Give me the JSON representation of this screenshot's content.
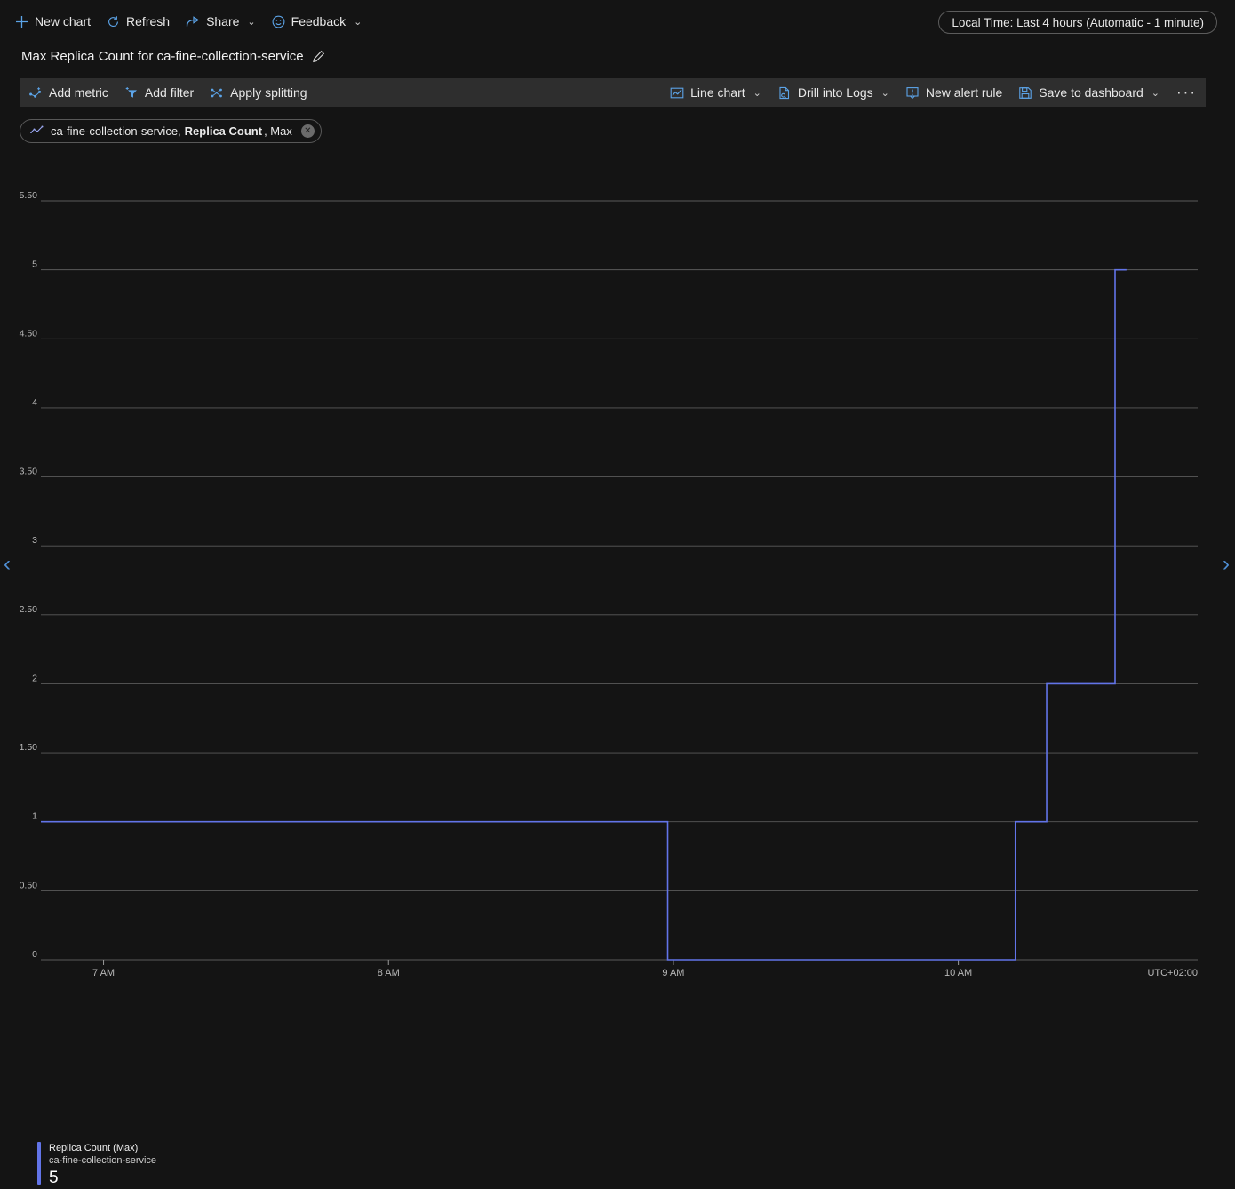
{
  "command_bar": {
    "items": [
      {
        "label": "New chart",
        "icon": "plus-icon"
      },
      {
        "label": "Refresh",
        "icon": "refresh-icon"
      },
      {
        "label": "Share",
        "icon": "share-icon",
        "chevron": "⌄"
      },
      {
        "label": "Feedback",
        "icon": "smiley-icon",
        "chevron": "⌄"
      }
    ],
    "time_range": "Local Time: Last 4 hours (Automatic - 1 minute)"
  },
  "chart_header": {
    "title": "Max Replica Count for ca-fine-collection-service",
    "edit_icon": "pencil-icon"
  },
  "toolbar": {
    "left": [
      {
        "label": "Add metric",
        "icon": "add-metric-icon"
      },
      {
        "label": "Add filter",
        "icon": "add-filter-icon"
      },
      {
        "label": "Apply splitting",
        "icon": "apply-splitting-icon"
      }
    ],
    "right": [
      {
        "label": "Line chart",
        "icon": "line-chart-icon",
        "chevron": "⌄"
      },
      {
        "label": "Drill into Logs",
        "icon": "drill-logs-icon",
        "chevron": "⌄"
      },
      {
        "label": "New alert rule",
        "icon": "alert-rule-icon",
        "chevron": ""
      },
      {
        "label": "Save to dashboard",
        "icon": "save-icon",
        "chevron": "⌄"
      }
    ],
    "overflow_label": "···"
  },
  "metric_chip": {
    "icon": "scatter-line-icon",
    "resource": "ca-fine-collection-service,",
    "metric": "Replica Count",
    "aggregation": ", Max",
    "close_icon": "close-icon"
  },
  "navigation": {
    "prev_icon": "chevron-left-icon",
    "next_icon": "chevron-right-icon"
  },
  "legend": {
    "metric_label": "Replica Count (Max)",
    "resource_label": "ca-fine-collection-service",
    "value": "5",
    "color": "#6274e8"
  },
  "colors": {
    "background": "#141414",
    "toolbar_background": "#2e2e2e",
    "series": "#6274e8",
    "gridline": "#5a5a5a",
    "accent_icon": "#5ca4e8"
  },
  "chart_data": {
    "type": "line",
    "title": "Max Replica Count for ca-fine-collection-service",
    "xlabel": "",
    "ylabel": "",
    "timezone_label": "UTC+02:00",
    "grid": true,
    "legend_position": "bottom-left",
    "interpolation": "step-after",
    "ylim": [
      0,
      5.5
    ],
    "ytick_labels": [
      "5.50",
      "5",
      "4.50",
      "4",
      "3.50",
      "3",
      "2.50",
      "2",
      "1.50",
      "1",
      "0.50",
      "0"
    ],
    "ytick_values": [
      5.5,
      5,
      4.5,
      4,
      3.5,
      3,
      2.5,
      2,
      1.5,
      1,
      0.5,
      0
    ],
    "xtick_labels": [
      "7 AM",
      "8 AM",
      "9 AM",
      "10 AM"
    ],
    "xtick_times": [
      7.0,
      8.0,
      9.0,
      10.0
    ],
    "xlim": [
      6.78,
      10.84
    ],
    "series": [
      {
        "name": "Replica Count (Max)",
        "resource": "ca-fine-collection-service",
        "color": "#6274e8",
        "points": [
          {
            "t": 6.78,
            "v": 1
          },
          {
            "t": 8.98,
            "v": 1
          },
          {
            "t": 8.98,
            "v": 0
          },
          {
            "t": 10.2,
            "v": 0
          },
          {
            "t": 10.2,
            "v": 1
          },
          {
            "t": 10.31,
            "v": 1
          },
          {
            "t": 10.31,
            "v": 2
          },
          {
            "t": 10.55,
            "v": 2
          },
          {
            "t": 10.55,
            "v": 5
          },
          {
            "t": 10.59,
            "v": 5
          }
        ]
      }
    ]
  }
}
